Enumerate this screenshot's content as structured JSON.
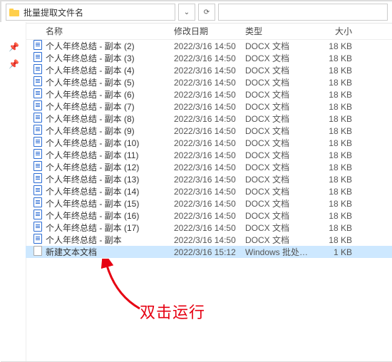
{
  "address_bar": {
    "folder_name": "批量提取文件名"
  },
  "columns": {
    "name": "名称",
    "date": "修改日期",
    "type": "类型",
    "size": "大小"
  },
  "files": [
    {
      "icon": "doc",
      "name": "个人年终总结 - 副本 (2)",
      "date": "2022/3/16 14:50",
      "type": "DOCX 文档",
      "size": "18 KB"
    },
    {
      "icon": "doc",
      "name": "个人年终总结 - 副本 (3)",
      "date": "2022/3/16 14:50",
      "type": "DOCX 文档",
      "size": "18 KB"
    },
    {
      "icon": "doc",
      "name": "个人年终总结 - 副本 (4)",
      "date": "2022/3/16 14:50",
      "type": "DOCX 文档",
      "size": "18 KB"
    },
    {
      "icon": "doc",
      "name": "个人年终总结 - 副本 (5)",
      "date": "2022/3/16 14:50",
      "type": "DOCX 文档",
      "size": "18 KB"
    },
    {
      "icon": "doc",
      "name": "个人年终总结 - 副本 (6)",
      "date": "2022/3/16 14:50",
      "type": "DOCX 文档",
      "size": "18 KB"
    },
    {
      "icon": "doc",
      "name": "个人年终总结 - 副本 (7)",
      "date": "2022/3/16 14:50",
      "type": "DOCX 文档",
      "size": "18 KB"
    },
    {
      "icon": "doc",
      "name": "个人年终总结 - 副本 (8)",
      "date": "2022/3/16 14:50",
      "type": "DOCX 文档",
      "size": "18 KB"
    },
    {
      "icon": "doc",
      "name": "个人年终总结 - 副本 (9)",
      "date": "2022/3/16 14:50",
      "type": "DOCX 文档",
      "size": "18 KB"
    },
    {
      "icon": "doc",
      "name": "个人年终总结 - 副本 (10)",
      "date": "2022/3/16 14:50",
      "type": "DOCX 文档",
      "size": "18 KB"
    },
    {
      "icon": "doc",
      "name": "个人年终总结 - 副本 (11)",
      "date": "2022/3/16 14:50",
      "type": "DOCX 文档",
      "size": "18 KB"
    },
    {
      "icon": "doc",
      "name": "个人年终总结 - 副本 (12)",
      "date": "2022/3/16 14:50",
      "type": "DOCX 文档",
      "size": "18 KB"
    },
    {
      "icon": "doc",
      "name": "个人年终总结 - 副本 (13)",
      "date": "2022/3/16 14:50",
      "type": "DOCX 文档",
      "size": "18 KB"
    },
    {
      "icon": "doc",
      "name": "个人年终总结 - 副本 (14)",
      "date": "2022/3/16 14:50",
      "type": "DOCX 文档",
      "size": "18 KB"
    },
    {
      "icon": "doc",
      "name": "个人年终总结 - 副本 (15)",
      "date": "2022/3/16 14:50",
      "type": "DOCX 文档",
      "size": "18 KB"
    },
    {
      "icon": "doc",
      "name": "个人年终总结 - 副本 (16)",
      "date": "2022/3/16 14:50",
      "type": "DOCX 文档",
      "size": "18 KB"
    },
    {
      "icon": "doc",
      "name": "个人年终总结 - 副本 (17)",
      "date": "2022/3/16 14:50",
      "type": "DOCX 文档",
      "size": "18 KB"
    },
    {
      "icon": "doc",
      "name": "个人年终总结 - 副本",
      "date": "2022/3/16 14:50",
      "type": "DOCX 文档",
      "size": "18 KB"
    },
    {
      "icon": "txt",
      "name": "新建文本文档",
      "date": "2022/3/16 15:12",
      "type": "Windows 批处理...",
      "size": "1 KB",
      "selected": true
    }
  ],
  "annotation": "双击运行"
}
